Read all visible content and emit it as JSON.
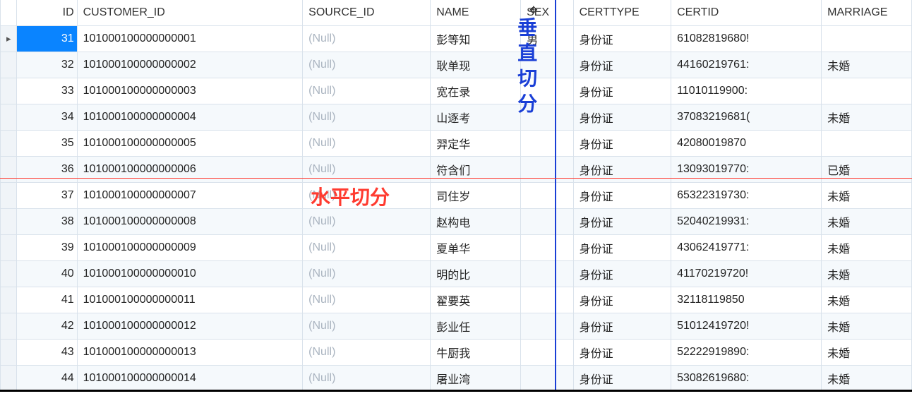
{
  "table": {
    "columns": [
      "ID",
      "CUSTOMER_ID",
      "SOURCE_ID",
      "NAME",
      "SEX",
      "CERTTYPE",
      "CERTID",
      "MARRIAGE"
    ],
    "null_label": "(Null)",
    "rows": [
      {
        "_sel": true,
        "id": "31",
        "customer_id": "101000100000000001",
        "source_id": null,
        "name": "彭等知",
        "sex": "男",
        "certtype": "身份证",
        "certid": "61082819680!",
        "marriage": ""
      },
      {
        "id": "32",
        "customer_id": "101000100000000002",
        "source_id": null,
        "name": "耿单现",
        "sex": "",
        "certtype": "身份证",
        "certid": "44160219761:",
        "marriage": "未婚"
      },
      {
        "id": "33",
        "customer_id": "101000100000000003",
        "source_id": null,
        "name": "宽在录",
        "sex": "",
        "certtype": "身份证",
        "certid": "11010119900:",
        "marriage": ""
      },
      {
        "id": "34",
        "customer_id": "101000100000000004",
        "source_id": null,
        "name": "山逐考",
        "sex": "",
        "certtype": "身份证",
        "certid": "37083219681(",
        "marriage": "未婚"
      },
      {
        "id": "35",
        "customer_id": "101000100000000005",
        "source_id": null,
        "name": "羿定华",
        "sex": "",
        "certtype": "身份证",
        "certid": "42080019870",
        "marriage": ""
      },
      {
        "id": "36",
        "customer_id": "101000100000000006",
        "source_id": null,
        "name": "符含们",
        "sex": "",
        "certtype": "身份证",
        "certid": "13093019770:",
        "marriage": "已婚"
      },
      {
        "id": "37",
        "customer_id": "101000100000000007",
        "source_id": null,
        "name": "司住岁",
        "sex": "",
        "certtype": "身份证",
        "certid": "65322319730:",
        "marriage": "未婚"
      },
      {
        "id": "38",
        "customer_id": "101000100000000008",
        "source_id": null,
        "name": "赵构电",
        "sex": "",
        "certtype": "身份证",
        "certid": "52040219931:",
        "marriage": "未婚"
      },
      {
        "id": "39",
        "customer_id": "101000100000000009",
        "source_id": null,
        "name": "夏单华",
        "sex": "",
        "certtype": "身份证",
        "certid": "43062419771:",
        "marriage": "未婚"
      },
      {
        "id": "40",
        "customer_id": "101000100000000010",
        "source_id": null,
        "name": "明的比",
        "sex": "",
        "certtype": "身份证",
        "certid": "41170219720!",
        "marriage": "未婚"
      },
      {
        "id": "41",
        "customer_id": "101000100000000011",
        "source_id": null,
        "name": "翟要英",
        "sex": "",
        "certtype": "身份证",
        "certid": "32118119850",
        "marriage": "未婚"
      },
      {
        "id": "42",
        "customer_id": "101000100000000012",
        "source_id": null,
        "name": "彭业任",
        "sex": "",
        "certtype": "身份证",
        "certid": "51012419720!",
        "marriage": "未婚"
      },
      {
        "id": "43",
        "customer_id": "101000100000000013",
        "source_id": null,
        "name": "牛厨我",
        "sex": "",
        "certtype": "身份证",
        "certid": "52222919890:",
        "marriage": "未婚"
      },
      {
        "id": "44",
        "customer_id": "101000100000000014",
        "source_id": null,
        "name": "屠业湾",
        "sex": "",
        "certtype": "身份证",
        "certid": "53082619680:",
        "marriage": "未婚"
      }
    ]
  },
  "labels": {
    "vertical_split": "垂直切分",
    "horizontal_split": "水平切分"
  }
}
